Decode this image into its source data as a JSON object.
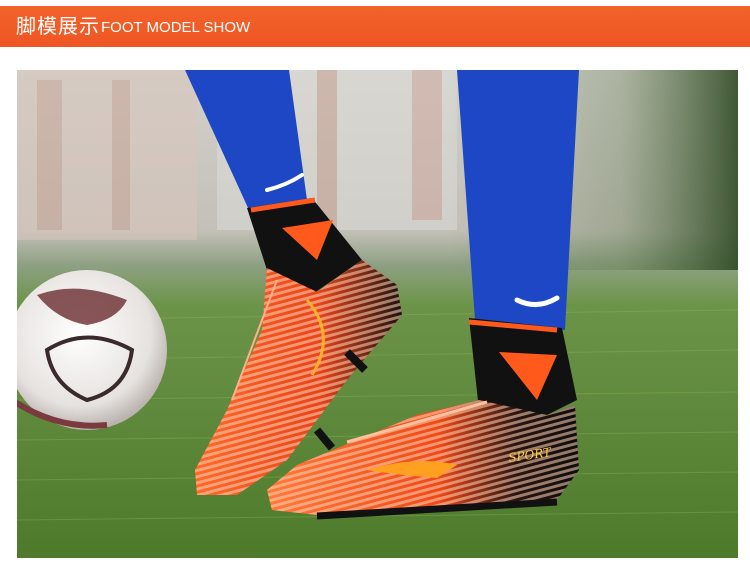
{
  "header": {
    "title_zh": "脚模展示",
    "title_en": "FOOT MODEL SHOW",
    "color": "#f05a26"
  },
  "photo": {
    "brand_text": "SPORT",
    "colors": {
      "sock": "#1d47c4",
      "boot_orange": "#ff5a1c",
      "boot_black": "#111111",
      "grass": "#5a8a35"
    }
  }
}
